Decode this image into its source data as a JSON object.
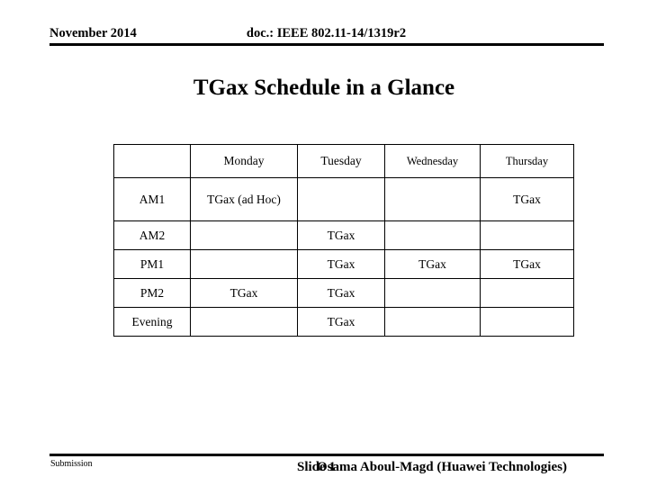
{
  "header": {
    "date": "November 2014",
    "doc": "doc.: IEEE 802.11-14/1319r2"
  },
  "title": "TGax Schedule in a Glance",
  "schedule": {
    "corner_label": "",
    "columns": [
      "Monday",
      "Tuesday",
      "Wednesday",
      "Thursday"
    ],
    "rows": [
      {
        "label": "AM1",
        "cells": [
          "TGax (ad Hoc)",
          "",
          "",
          "TGax"
        ]
      },
      {
        "label": "AM2",
        "cells": [
          "",
          "TGax",
          "",
          ""
        ]
      },
      {
        "label": "PM1",
        "cells": [
          "",
          "TGax",
          "TGax",
          "TGax"
        ]
      },
      {
        "label": "PM2",
        "cells": [
          "TGax",
          "TGax",
          "",
          ""
        ]
      },
      {
        "label": "Evening",
        "cells": [
          "",
          "TGax",
          "",
          ""
        ]
      }
    ]
  },
  "footer": {
    "submission": "Submission",
    "slide_number": "Slide 1",
    "author": "Osama Aboul-Magd (Huawei Technologies)"
  }
}
